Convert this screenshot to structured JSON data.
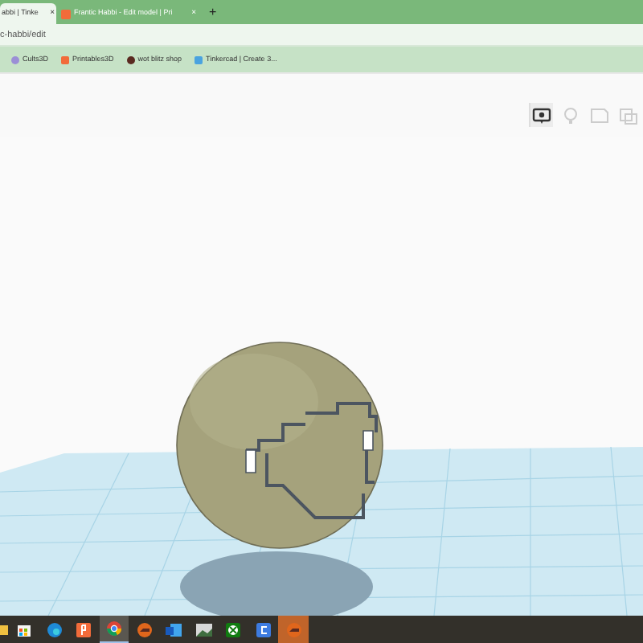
{
  "tabs": [
    {
      "label": "abbi | Tinke",
      "selected": true,
      "close": "×"
    },
    {
      "label": "Frantic Habbi - Edit model | Pri",
      "selected": false,
      "close": "×"
    }
  ],
  "new_tab": "+",
  "address": {
    "value": "c-habbi/edit"
  },
  "bookmarks": [
    {
      "label": "Cults3D",
      "kind": "cults"
    },
    {
      "label": "Printables3D",
      "kind": "printables"
    },
    {
      "label": "wot blitz shop",
      "kind": "blitz"
    },
    {
      "label": "Tinkercad | Create 3...",
      "kind": "tinkercad"
    }
  ],
  "toolbar": [
    {
      "kind": "view",
      "selected": true
    },
    {
      "kind": "bulb",
      "selected": false
    },
    {
      "kind": "note",
      "selected": false
    },
    {
      "kind": "copy",
      "selected": false
    }
  ],
  "taskbar": [
    {
      "kind": "folder",
      "selected": false,
      "highlighted": false
    },
    {
      "kind": "store",
      "selected": false,
      "highlighted": false
    },
    {
      "kind": "edge",
      "selected": false,
      "highlighted": false
    },
    {
      "kind": "printables",
      "selected": false,
      "highlighted": false
    },
    {
      "kind": "chrome",
      "selected": true,
      "highlighted": false
    },
    {
      "kind": "blitz",
      "selected": false,
      "highlighted": false
    },
    {
      "kind": "word",
      "selected": false,
      "highlighted": false
    },
    {
      "kind": "photos",
      "selected": false,
      "highlighted": false
    },
    {
      "kind": "xbox",
      "selected": false,
      "highlighted": false
    },
    {
      "kind": "cad",
      "selected": false,
      "highlighted": false
    },
    {
      "kind": "blitz",
      "selected": false,
      "highlighted": true
    }
  ]
}
